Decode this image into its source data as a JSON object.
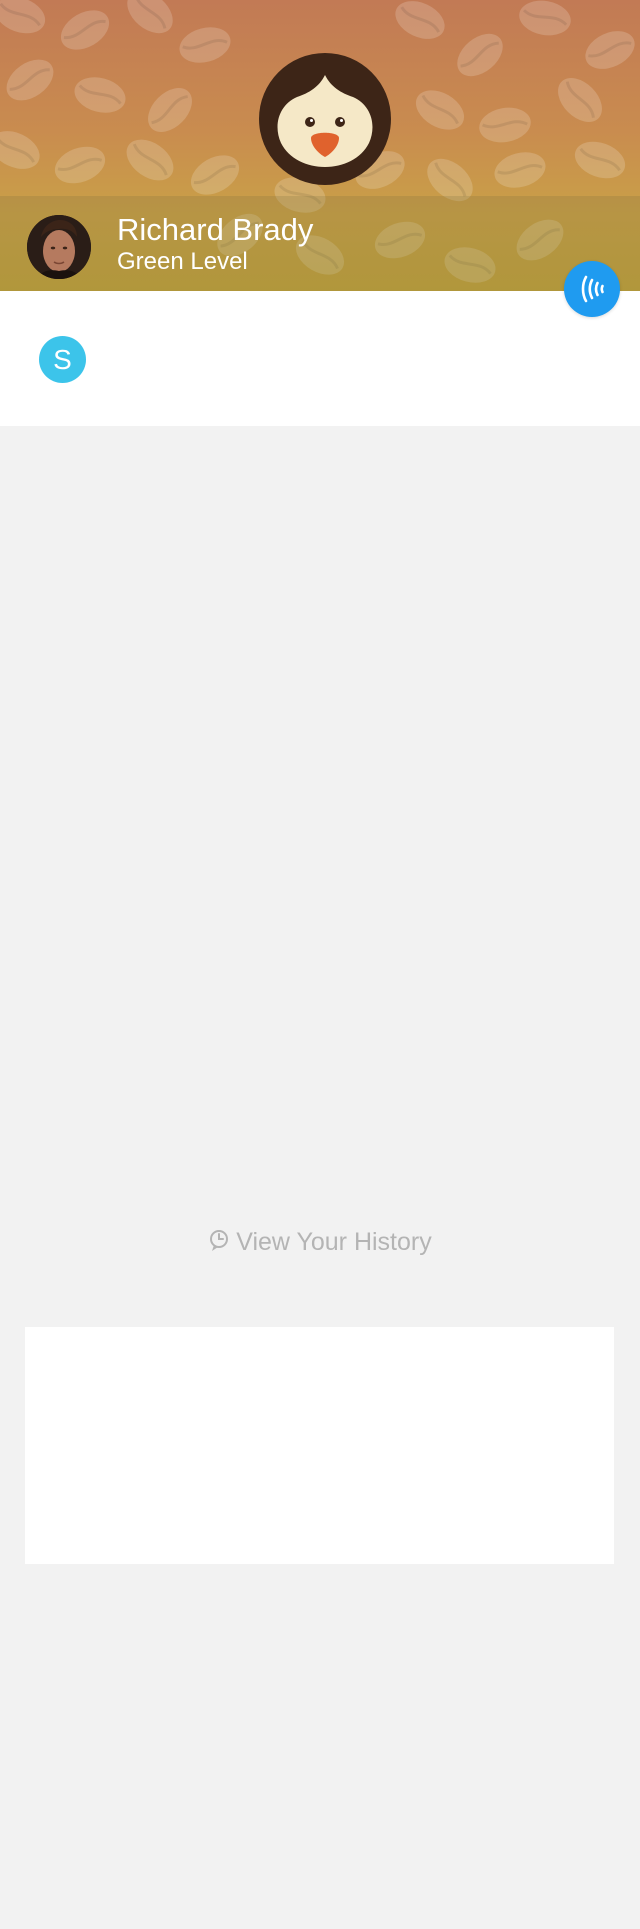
{
  "profile": {
    "name": "Richard Brady",
    "level": "Green Level",
    "badge_letter": "S"
  },
  "history": {
    "label": "View Your History",
    "icon": "history-clock-icon"
  },
  "icons": {
    "nfc": "nfc-icon",
    "mascot": "penguin-icon"
  },
  "colors": {
    "accent_blue": "#1f9bf0",
    "badge_cyan": "#3cc4ea",
    "beak_orange": "#e0622d",
    "muted_text": "#b4b4b4",
    "background": "#f2f2f2"
  }
}
